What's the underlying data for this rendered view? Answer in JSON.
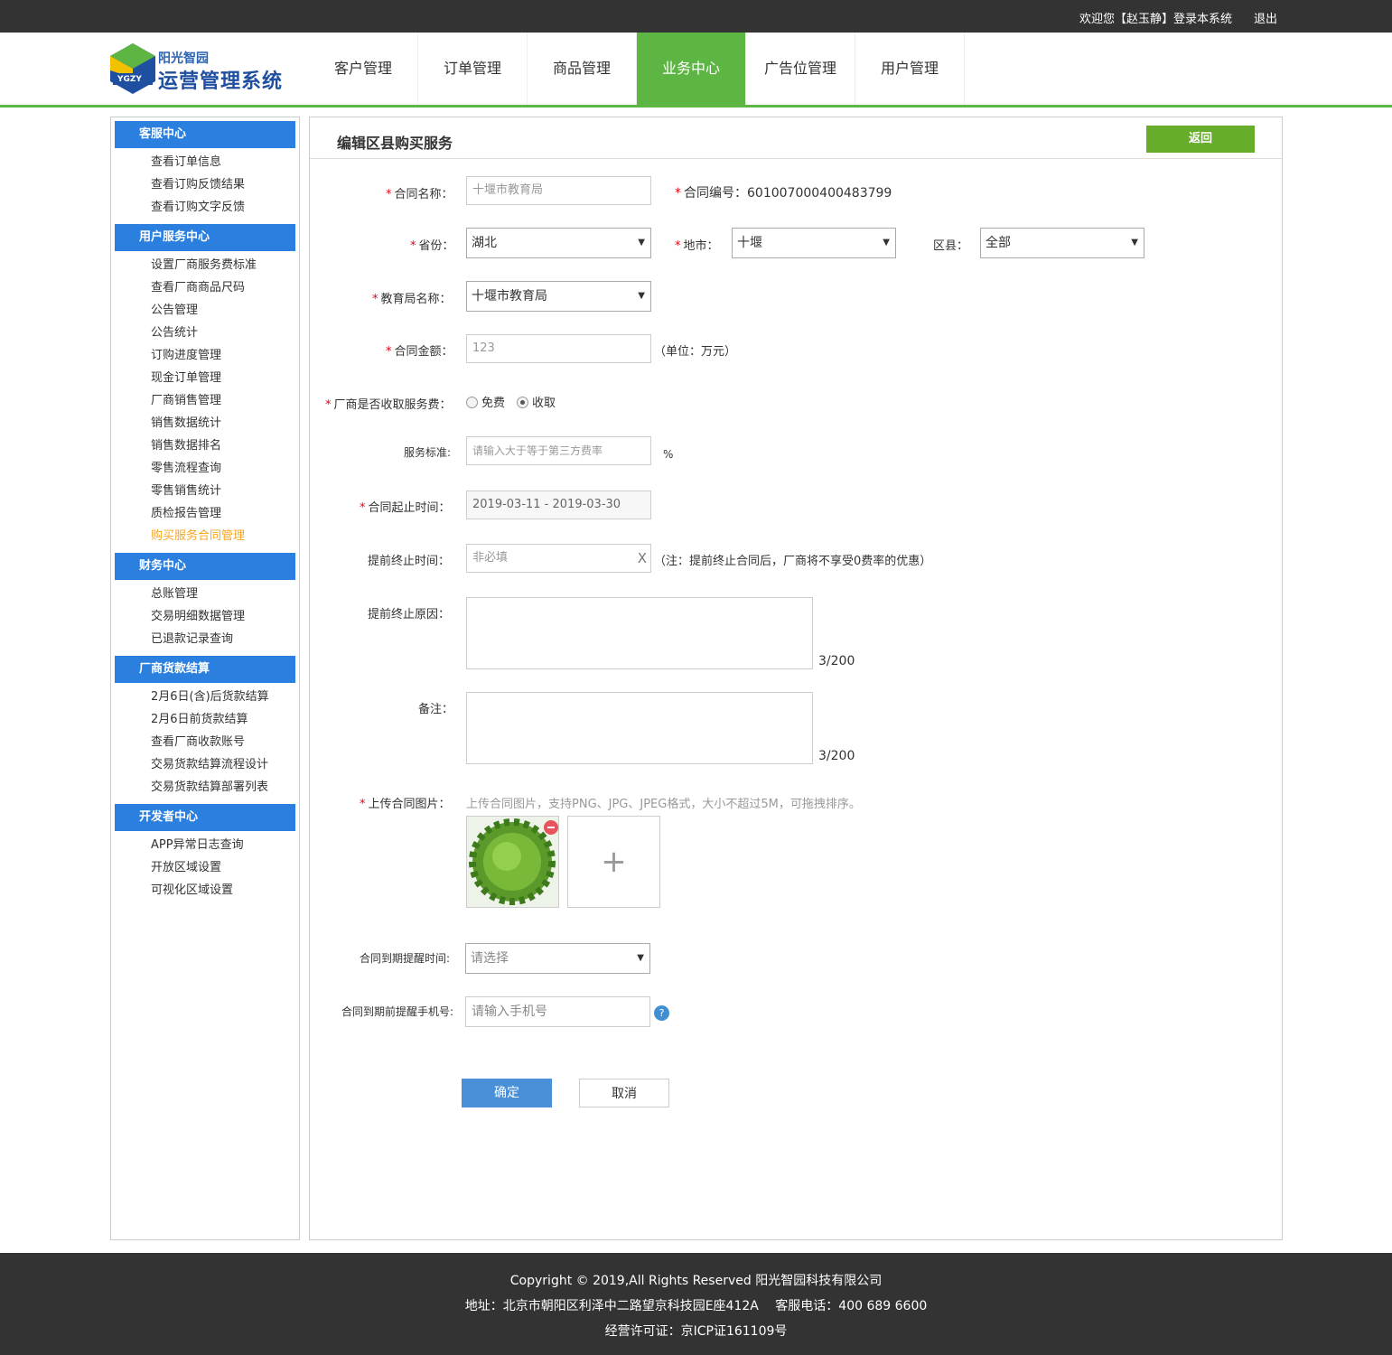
{
  "topbar": {
    "welcome": "欢迎您【赵玉静】登录本系统",
    "logout": "退出"
  },
  "logo": {
    "line1": "阳光智园",
    "line2": "运营管理系统",
    "badge": "YGZY"
  },
  "nav": [
    "客户管理",
    "订单管理",
    "商品管理",
    "业务中心",
    "广告位管理",
    "用户管理"
  ],
  "sidebar": {
    "groups": [
      {
        "title": "客服中心",
        "items": [
          "查看订单信息",
          "查看订购反馈结果",
          "查看订购文字反馈"
        ]
      },
      {
        "title": "用户服务中心",
        "items": [
          "设置厂商服务费标准",
          "查看厂商商品尺码",
          "公告管理",
          "公告统计",
          "订购进度管理",
          "现金订单管理",
          "厂商销售管理",
          "销售数据统计",
          "销售数据排名",
          "零售流程查询",
          "零售销售统计",
          "质检报告管理",
          "购买服务合同管理"
        ]
      },
      {
        "title": "财务中心",
        "items": [
          "总账管理",
          "交易明细数据管理",
          "已退款记录查询"
        ]
      },
      {
        "title": "厂商货款结算",
        "items": [
          "2月6日(含)后货款结算",
          "2月6日前货款结算",
          "查看厂商收款账号",
          "交易货款结算流程设计",
          "交易货款结算部署列表"
        ]
      },
      {
        "title": "开发者中心",
        "items": [
          "APP异常日志查询",
          "开放区域设置",
          "可视化区域设置"
        ]
      }
    ]
  },
  "panel": {
    "title": "编辑区县购买服务",
    "back": "返回"
  },
  "form": {
    "contract_name_label": "合同名称：",
    "contract_name_value": "十堰市教育局",
    "contract_no_label": "合同编号：",
    "contract_no_value": "601007000400483799",
    "province_label": "省份：",
    "province_value": "湖北",
    "city_label": "地市：",
    "city_value": "十堰",
    "county_label": "区县：",
    "county_value": "全部",
    "bureau_label": "教育局名称：",
    "bureau_value": "十堰市教育局",
    "amount_label": "合同金额：",
    "amount_value": "123",
    "amount_unit": "（单位：万元）",
    "fee_label": "厂商是否收取服务费：",
    "fee_free": "免费",
    "fee_charge": "收取",
    "standard_label": "服务标准:",
    "standard_placeholder": "请输入大于等于第三方费率",
    "standard_unit": "%",
    "period_label": "合同起止时间：",
    "period_value": "2019-03-11 - 2019-03-30",
    "early_end_label": "提前终止时间：",
    "early_end_placeholder": "非必填",
    "early_end_clear": "X",
    "early_end_note": "（注：提前终止合同后，厂商将不享受0费率的优惠）",
    "early_reason_label": "提前终止原因：",
    "early_reason_count": "3/200",
    "remark_label": "备注：",
    "remark_count": "3/200",
    "upload_label": "上传合同图片：",
    "upload_hint": "上传合同图片，支持PNG、JPG、JPEG格式，大小不超过5M，可拖拽排序。",
    "upload_add": "+",
    "remind_label": "合同到期提醒时间:",
    "remind_placeholder": "请选择",
    "phone_label": "合同到期前提醒手机号:",
    "phone_placeholder": "请输入手机号",
    "help": "?",
    "confirm": "确定",
    "cancel": "取消"
  },
  "footer": {
    "copyright": "Copyright © 2019,All Rights Reserved 阳光智园科技有限公司",
    "address": "地址：北京市朝阳区利泽中二路望京科技园E座412A　 客服电话：400 689 6600",
    "license": "经营许可证：京ICP证161109号"
  },
  "colors": {
    "brand_green": "#5db543",
    "sidebar_blue": "#2b7fdf",
    "confirm_blue": "#4a90d9",
    "back_green": "#67ad2c",
    "active_link": "#f5a623"
  }
}
